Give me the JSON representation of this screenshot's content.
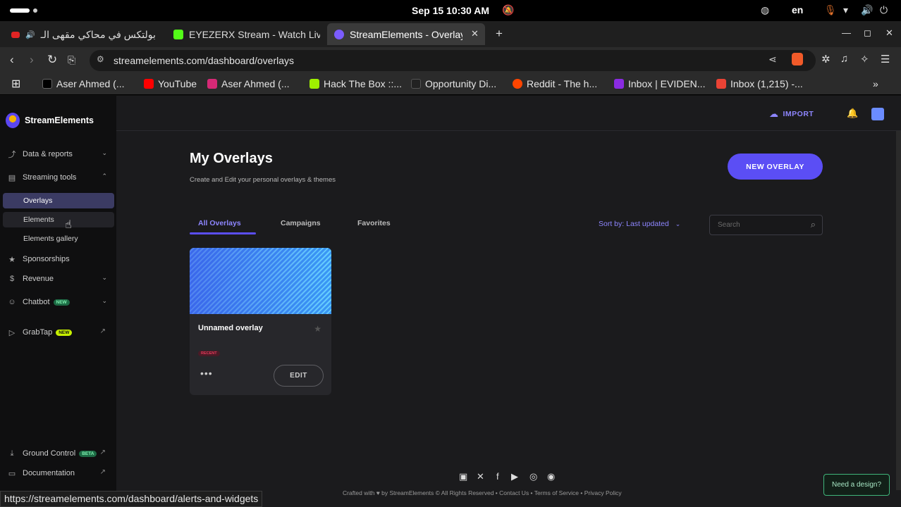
{
  "os": {
    "clock": "Sep 15  10:30 AM",
    "lang": "en"
  },
  "browser": {
    "tabs": [
      {
        "title": "بولتكس في محاكي مقهى الـ",
        "color": "#e02424"
      },
      {
        "title": "EYEZERX Stream - Watch Live",
        "color": "#53fc18"
      },
      {
        "title": "StreamElements - Overlays",
        "color": "#7b5cff"
      }
    ],
    "url": "streamelements.com/dashboard/overlays",
    "bookmarks": [
      {
        "label": "Aser Ahmed (...",
        "color": "#000000"
      },
      {
        "label": "YouTube",
        "color": "#ff0000"
      },
      {
        "label": "Aser Ahmed (...",
        "color": "#d62976"
      },
      {
        "label": "Hack The Box ::...",
        "color": "#9fef00"
      },
      {
        "label": "Opportunity Di...",
        "color": "#222222"
      },
      {
        "label": "Reddit - The h...",
        "color": "#ff4500"
      },
      {
        "label": "Inbox | EVIDEN...",
        "color": "#8a2be2"
      },
      {
        "label": "Inbox (1,215) -...",
        "color": "#ea4335"
      }
    ],
    "status_url": "https://streamelements.com/dashboard/alerts-and-widgets"
  },
  "sidebar": {
    "brand": "StreamElements",
    "items": [
      {
        "label": "Data & reports"
      },
      {
        "label": "Streaming tools"
      }
    ],
    "subitems": [
      {
        "label": "Overlays"
      },
      {
        "label": "Elements"
      },
      {
        "label": "Elements gallery"
      }
    ],
    "more": [
      {
        "label": "Sponsorships"
      },
      {
        "label": "Revenue"
      },
      {
        "label": "Chatbot",
        "badge": "NEW"
      },
      {
        "label": "GrabTap",
        "badge": "NEW"
      }
    ],
    "bottom": [
      {
        "label": "Ground Control",
        "badge": "BETA"
      },
      {
        "label": "Documentation"
      }
    ]
  },
  "header": {
    "import_label": "IMPORT"
  },
  "main": {
    "title": "My Overlays",
    "subtitle": "Create and Edit your personal overlays & themes",
    "new_overlay_label": "NEW OVERLAY",
    "tabs": [
      {
        "label": "All Overlays"
      },
      {
        "label": "Campaigns"
      },
      {
        "label": "Favorites"
      }
    ],
    "sort_label": "Sort by: Last updated",
    "search_placeholder": "Search",
    "overlay": {
      "name": "Unnamed overlay",
      "badge": "RECENT",
      "more": "•••",
      "edit_label": "EDIT"
    }
  },
  "footer": {
    "text": "Crafted with ♥ by  StreamElements  © All Rights Reserved • Contact Us • Terms of Service • Privacy Policy",
    "need_design": "Need a design?"
  }
}
